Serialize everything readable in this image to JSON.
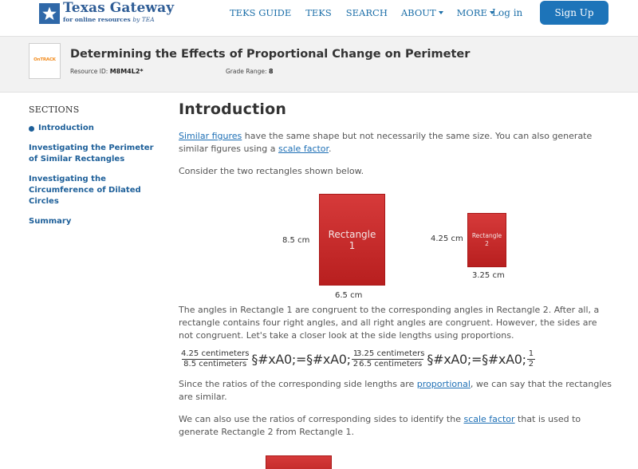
{
  "header": {
    "logo_title": "Texas Gateway",
    "logo_sub_bold": "for online resources",
    "logo_sub_italic": "by TEA",
    "nav": [
      {
        "label": "TEKS GUIDE",
        "dropdown": false
      },
      {
        "label": "TEKS",
        "dropdown": false
      },
      {
        "label": "SEARCH",
        "dropdown": false
      },
      {
        "label": "ABOUT",
        "dropdown": true
      },
      {
        "label": "MORE",
        "dropdown": true
      }
    ],
    "login": "Log in",
    "signup": "Sign Up"
  },
  "resource": {
    "badge_brand": "OnTRACK",
    "title": "Determining the Effects of Proportional Change on Perimeter",
    "id_label": "Resource ID:",
    "id_value": "M8M4L2*",
    "grade_label": "Grade Range:",
    "grade_value": "8"
  },
  "sidebar": {
    "heading": "SECTIONS",
    "items": [
      {
        "label": "Introduction",
        "active": true
      },
      {
        "label": "Investigating the Perimeter of Similar Rectangles",
        "active": false
      },
      {
        "label": "Investigating the Circumference of Dilated Circles",
        "active": false
      },
      {
        "label": "Summary",
        "active": false
      }
    ]
  },
  "content": {
    "heading": "Introduction",
    "p1_link1": "Similar figures",
    "p1_text1": " have the same shape but not necessarily the same size. You can also generate similar figures using a ",
    "p1_link2": "scale factor",
    "p1_text2": ".",
    "p2": "Consider the two rectangles shown below.",
    "rect1": {
      "label_line1": "Rectangle",
      "label_line2": "1",
      "height": "8.5 cm",
      "width": "6.5 cm"
    },
    "rect2": {
      "label_line1": "Rectangle",
      "label_line2": "2",
      "height": "4.25 cm",
      "width": "3.25 cm"
    },
    "p3": "The angles in Rectangle 1 are congruent to the corresponding angles in Rectangle 2. After all, a rectangle contains four right angles, and all right angles are congruent. However, the sides are not congruent. Let's take a closer look at the side lengths using proportions.",
    "eq1": {
      "num": "4.25 centimeters",
      "den": "8.5 centimeters",
      "glyph": "§#xA0;=§#xA0;",
      "rnum": "1",
      "rden": "2"
    },
    "eq2": {
      "num": "3.25 centimeters",
      "den": "6.5 centimeters",
      "glyph": "§#xA0;=§#xA0;",
      "rnum": "1",
      "rden": "2"
    },
    "p4_text1": "Since the ratios of the corresponding side lengths are ",
    "p4_link": "proportional",
    "p4_text2": ", we can say that the rectangles are similar.",
    "p5_text1": "We can also use the ratios of corresponding sides to identify the ",
    "p5_link": "scale factor",
    "p5_text2": " that is used to generate Rectangle 2 from Rectangle 1."
  }
}
